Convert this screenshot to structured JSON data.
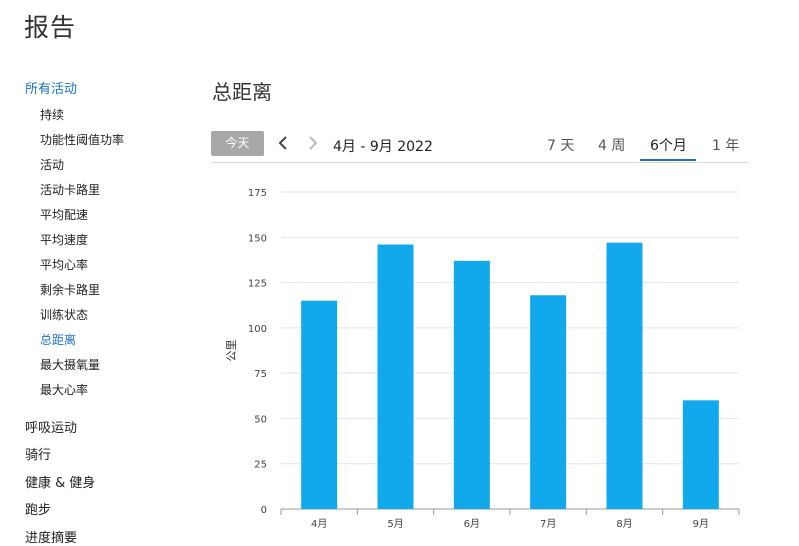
{
  "page": {
    "title": "报告"
  },
  "sidebar": {
    "top_category": "所有活动",
    "sub_items": [
      "持续",
      "功能性阈值功率",
      "活动",
      "活动卡路里",
      "平均配速",
      "平均速度",
      "平均心率",
      "剩余卡路里",
      "训练状态",
      "总距离",
      "最大摄氧量",
      "最大心率"
    ],
    "active_sub_item": "总距离",
    "categories": [
      "呼吸运动",
      "骑行",
      "健康 & 健身",
      "跑步",
      "进度摘要"
    ]
  },
  "main": {
    "section_title": "总距离",
    "toolbar": {
      "today_label": "今天",
      "prev_icon": "chevron-left-icon",
      "next_icon": "chevron-right-icon",
      "date_range": "4月 - 9月 2022",
      "period_tabs": [
        "7 天",
        "4 周",
        "6个月",
        "1 年"
      ],
      "active_tab": "6个月"
    }
  },
  "colors": {
    "bar": "#12a8ec",
    "accent": "#1a73c8",
    "today_button": "#a8a8a8"
  },
  "chart_data": {
    "type": "bar",
    "categories": [
      "4月",
      "5月",
      "6月",
      "7月",
      "8月",
      "9月"
    ],
    "values": [
      115,
      146,
      137,
      118,
      147,
      60
    ],
    "ylabel": "公里",
    "xlabel": "",
    "ylim": [
      0,
      175
    ],
    "yticks": [
      0,
      25,
      50,
      75,
      100,
      125,
      150,
      175
    ],
    "grid": true
  }
}
